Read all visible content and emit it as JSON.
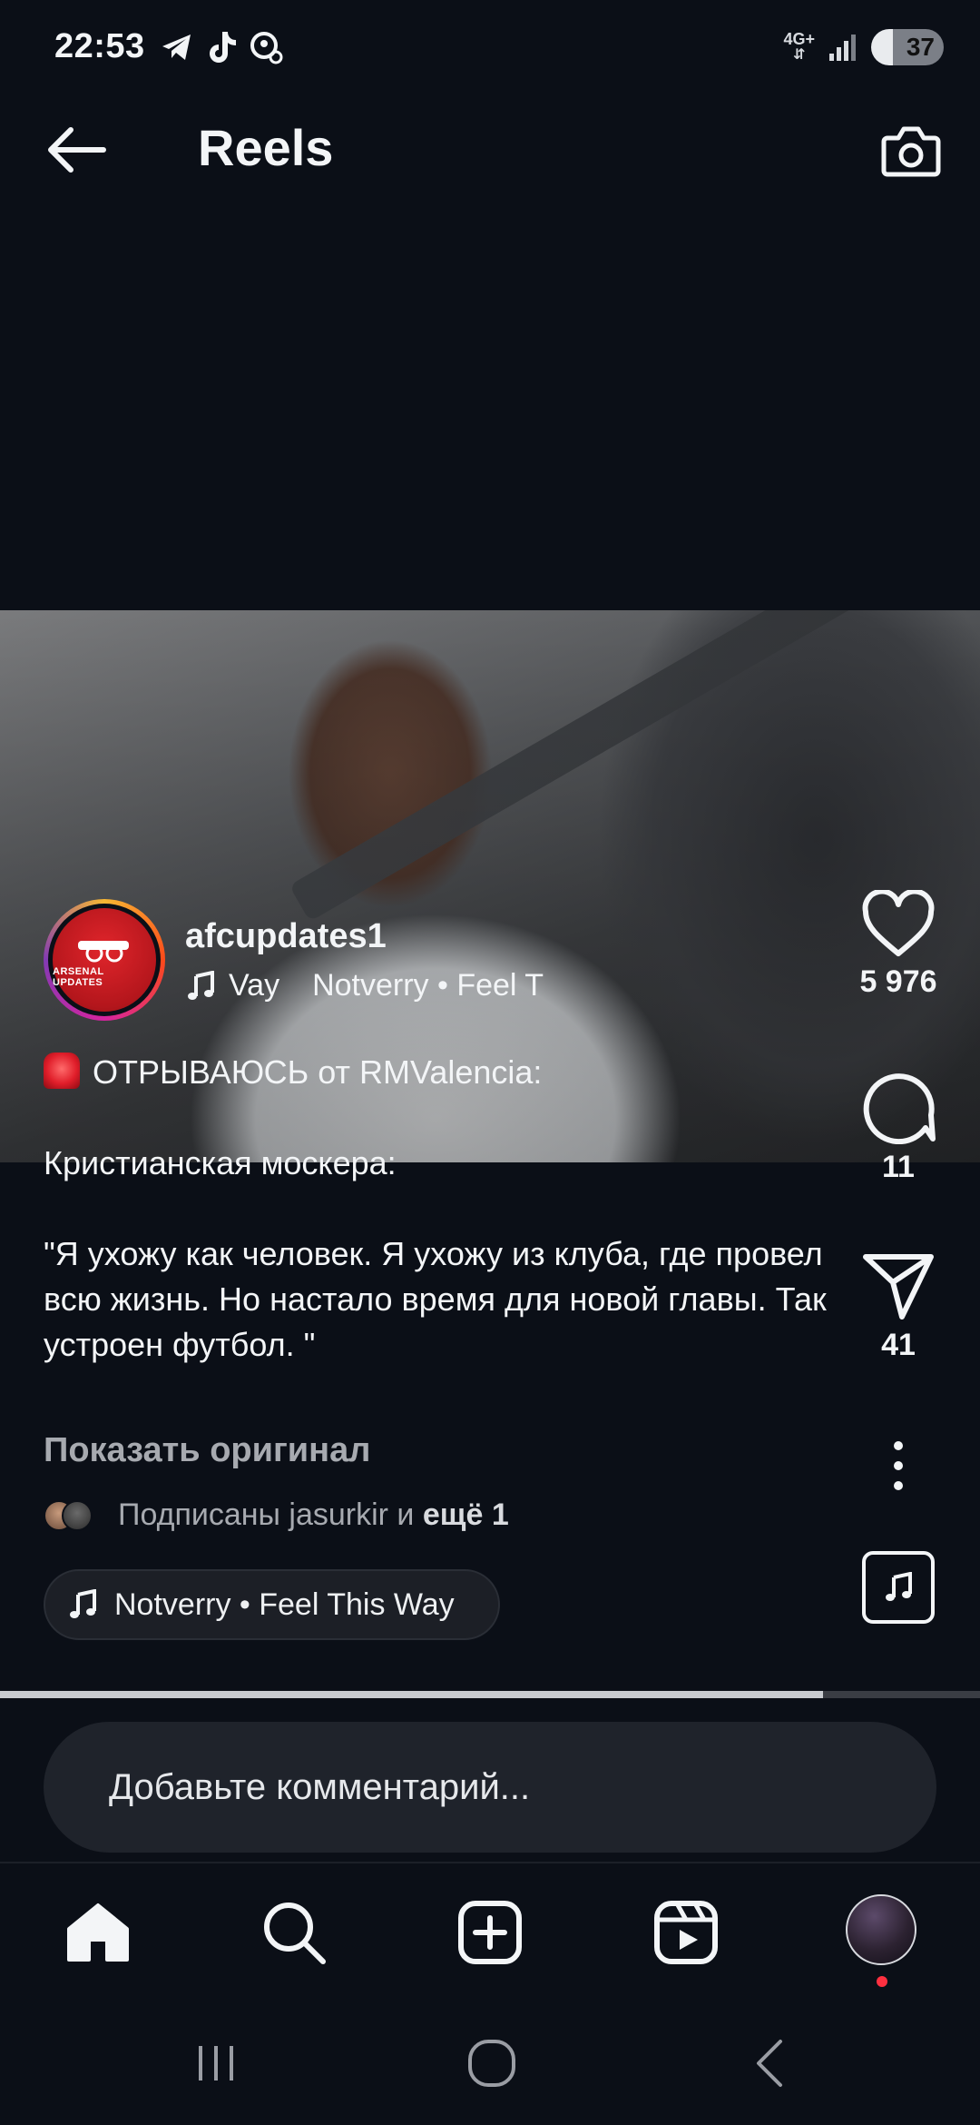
{
  "status_bar": {
    "time": "22:53",
    "network": "4G+",
    "battery": "37"
  },
  "header": {
    "title": "Reels"
  },
  "post": {
    "username": "afcupdates1",
    "avatar_text": "ARSENAL UPDATES",
    "audio_marquee_1": "Vay",
    "audio_marquee_2": "Notverry • Feel T",
    "caption": {
      "line1": "ОТРЫВАЮСЬ от RMValencia:",
      "line2": "Кристианская москера:",
      "line3": "\"Я ухожу как человек. Я ухожу из клуба, где провел всю жизнь. Но настало время для новой главы. Так устроен футбол. \""
    },
    "show_original": "Показать оригинал",
    "followed_by_prefix": "Подписаны jasurkir и",
    "followed_by_more": "ещё 1",
    "audio_label": "Notverry • Feel This Way",
    "progress_fraction": 0.84
  },
  "actions": {
    "likes": "5 976",
    "comments": "11",
    "shares": "41"
  },
  "comment_box": {
    "placeholder": "Добавьте комментарий..."
  },
  "icons": {
    "back": "arrow-left-icon",
    "camera": "camera-icon",
    "like": "heart-icon",
    "comment": "speech-bubble-icon",
    "share": "paper-plane-icon",
    "more": "vertical-dots-icon",
    "audio": "music-note-icon",
    "home": "home-icon",
    "search": "search-icon",
    "create": "plus-square-icon",
    "reels": "reels-icon"
  },
  "colors": {
    "background": "#0b0f17",
    "text": "#f3f5f7",
    "muted": "#a7aab0",
    "notification": "#ff3040"
  }
}
